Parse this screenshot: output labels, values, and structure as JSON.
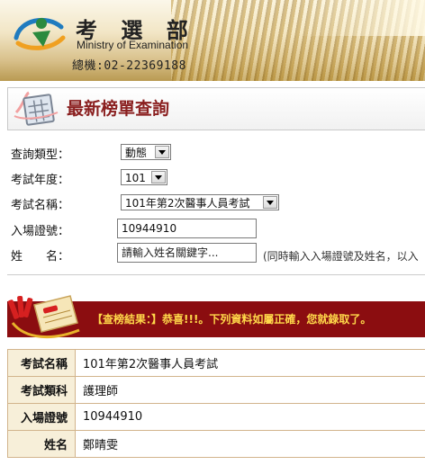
{
  "header": {
    "org_name_cn": "考 選 部",
    "org_name_en": "Ministry of Examination",
    "phone": "總機:02-22369188"
  },
  "page": {
    "title": "最新榜單查詢"
  },
  "form": {
    "query_type": {
      "label": "查詢類型：",
      "value": "動態"
    },
    "exam_year": {
      "label": "考試年度：",
      "value": "101"
    },
    "exam_name": {
      "label": "考試名稱：",
      "value": "101年第2次醫事人員考試"
    },
    "admission_no": {
      "label": "入場證號：",
      "value": "10944910"
    },
    "name": {
      "label": "姓　　名：",
      "placeholder": "請輸入姓名關鍵字..."
    },
    "hint": "(同時輸入入場證號及姓名，以入"
  },
  "result": {
    "banner_text": "【查榜結果：】恭喜!!!。下列資料如屬正確，您就錄取了。",
    "rows": [
      {
        "label": "考試名稱",
        "value": "101年第2次醫事人員考試"
      },
      {
        "label": "考試類科",
        "value": "護理師"
      },
      {
        "label": "入場證號",
        "value": "10944910"
      },
      {
        "label": "姓名",
        "value": "鄭晴雯"
      }
    ]
  },
  "colors": {
    "title_red": "#8a1f1f",
    "result_banner_bg": "#8b0d10",
    "result_banner_text": "#ffd84a",
    "table_header_bg": "#f7efd9"
  }
}
